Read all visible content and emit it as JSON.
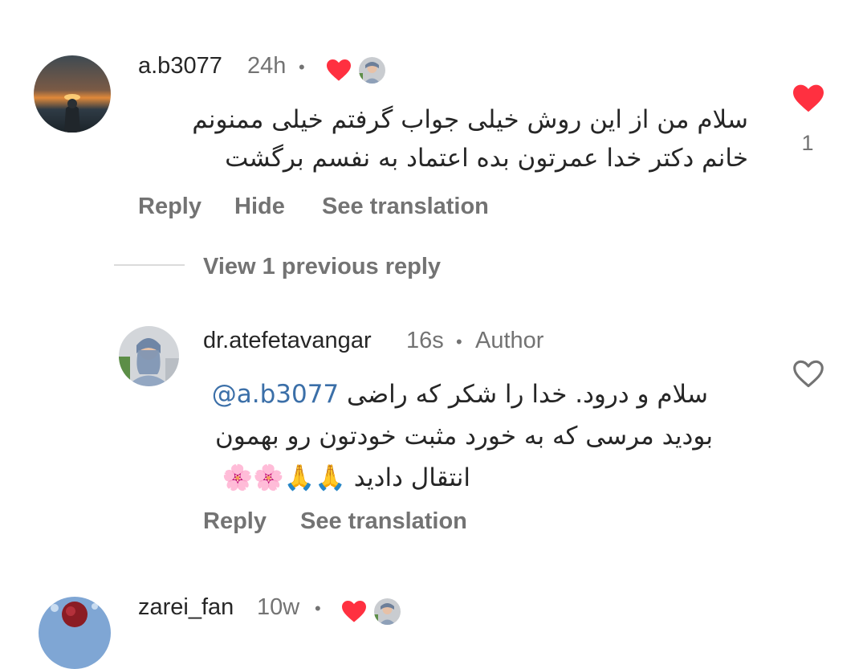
{
  "comments": [
    {
      "username": "a.b3077",
      "time": "24h",
      "text_line1": "سلام من از این روش خیلی جواب گرفتم خیلی ممنونم",
      "text_line2": "خانم دکتر خدا عمرتون بده اعتماد به نفسم برگشت",
      "reply_label": "Reply",
      "hide_label": "Hide",
      "translate_label": "See translation",
      "like_count": "1",
      "liked": true,
      "creator_liked": true
    }
  ],
  "view_replies_label": "View 1 previous reply",
  "reply": {
    "username": "dr.atefetavangar",
    "time": "16s",
    "author_badge": "Author",
    "mention": "@a.b3077",
    "text_line1_rest": "سلام و درود. خدا را شکر که راضی",
    "text_line2": "بودید مرسی که به خورد مثبت خودتون رو بهمون",
    "text_line3": "انتقال دادید 🙏🙏🌸🌸",
    "reply_label": "Reply",
    "translate_label": "See translation",
    "liked": false
  },
  "next_comment": {
    "username": "zarei_fan",
    "time": "10w",
    "creator_liked": true
  },
  "colors": {
    "like_red": "#ff3040",
    "text_primary": "#262626",
    "text_secondary": "#737373",
    "mention_blue": "#3b6fa8"
  }
}
